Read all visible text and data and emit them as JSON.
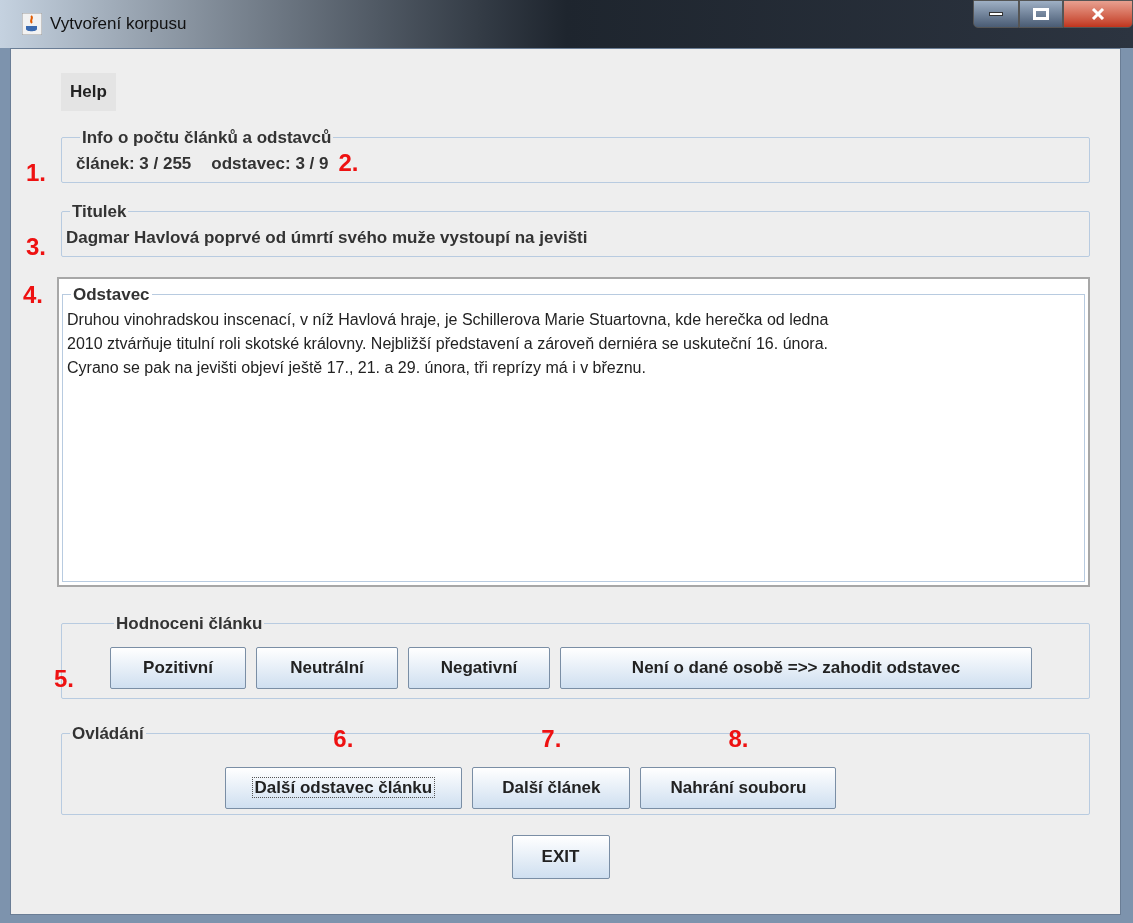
{
  "window": {
    "title": "Vytvoření korpusu"
  },
  "menu": [
    {
      "label": "Help"
    }
  ],
  "info": {
    "legend": "Info o počtu článků a odstavců",
    "marker": "1.",
    "article": "článek: 3 / 255",
    "paragraph": "odstavec: 3 / 9",
    "paragraph_marker": "2."
  },
  "title_group": {
    "legend": "Titulek",
    "marker": "3.",
    "text": "Dagmar Havlová poprvé od úmrtí svého muže vystoupí na jevišti"
  },
  "paragraph_group": {
    "legend": "Odstavec",
    "marker": "4.",
    "lines": [
      "Druhou vinohradskou inscenací, v níž Havlová hraje, je Schillerova Marie Stuartovna, kde herečka od ledna",
      "2010 ztvárňuje titulní roli skotské královny. Nejbližší představení a zároveň derniéra se uskuteční 16. února.",
      "Cyrano se pak na jevišti objeví ještě 17., 21. a 29. února, tři reprízy má i v březnu."
    ]
  },
  "rating": {
    "legend": "Hodnoceni článku",
    "marker": "5.",
    "buttons": [
      {
        "label": "Pozitivní"
      },
      {
        "label": "Neutrální"
      },
      {
        "label": "Negativní"
      },
      {
        "label": "Není o dané osobě =>> zahodit odstavec"
      }
    ]
  },
  "controls": {
    "legend": "Ovládání",
    "buttons": [
      {
        "label": "Další odstavec článku",
        "marker": "6.",
        "focused": true
      },
      {
        "label": "Další článek",
        "marker": "7.",
        "focused": false
      },
      {
        "label": "Nahrání souboru",
        "marker": "8.",
        "focused": false
      }
    ]
  },
  "exit": {
    "label": "EXIT"
  }
}
